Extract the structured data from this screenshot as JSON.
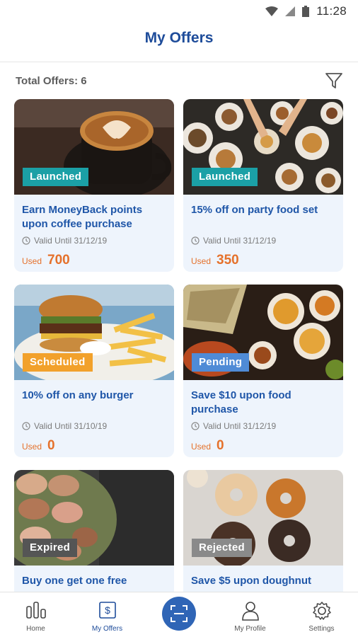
{
  "status_bar": {
    "time": "11:28"
  },
  "header": {
    "title": "My Offers"
  },
  "toolbar": {
    "total_offers": "Total Offers: 6",
    "filter_icon": "filter-icon"
  },
  "offers": [
    {
      "title": "Earn MoneyBack points upon coffee purchase",
      "status": "Launched",
      "status_color": "#1ba0a6",
      "validity": "Valid Until 31/12/19",
      "used_label": "Used",
      "used_value": "700",
      "image": "latte-art-coffee"
    },
    {
      "title": "15% off on party food set",
      "status": "Launched",
      "status_color": "#1ba0a6",
      "validity": "Valid Until 31/12/19",
      "used_label": "Used",
      "used_value": "350",
      "image": "party-food-table"
    },
    {
      "title": "10% off on any burger",
      "status": "Scheduled",
      "status_color": "#f2a12b",
      "validity": "Valid Until 31/10/19",
      "used_label": "Used",
      "used_value": "0",
      "image": "burger-and-fries"
    },
    {
      "title": "Save $10 upon food purchase",
      "status": "Pending",
      "status_color": "#4f8bd6",
      "validity": "Valid Until 31/12/19",
      "used_label": "Used",
      "used_value": "0",
      "image": "indian-food-spread"
    },
    {
      "title": "Buy one get one free",
      "status": "Expired",
      "status_color": "#555555",
      "image": "macarons"
    },
    {
      "title": "Save $5 upon doughnut",
      "status": "Rejected",
      "status_color": "#8a8a8a",
      "image": "doughnuts"
    }
  ],
  "bottom_nav": {
    "items": [
      {
        "label": "Home",
        "icon": "bar-chart-icon"
      },
      {
        "label": "My Offers",
        "icon": "dollar-tag-icon"
      },
      {
        "label": "",
        "icon": "scan-icon"
      },
      {
        "label": "My Profile",
        "icon": "person-icon"
      },
      {
        "label": "Settings",
        "icon": "gear-icon"
      }
    ]
  },
  "colors": {
    "brand_blue": "#1e4c9a",
    "accent_orange": "#e5712b",
    "card_bg": "#eef4fc"
  }
}
